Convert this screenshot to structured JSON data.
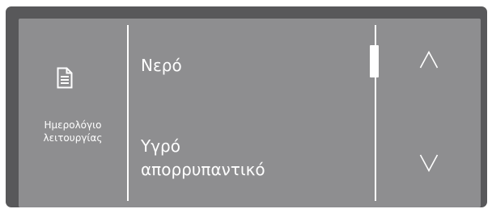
{
  "sidebar": {
    "icon": "document-icon",
    "label_line1": "Ημερολόγιο",
    "label_line2": "λειτουργίας"
  },
  "menu": {
    "items": [
      {
        "lines": [
          "Νερό"
        ]
      },
      {
        "lines": [
          "Υγρό",
          "απορρυπαντικό"
        ]
      }
    ]
  },
  "scroll": {
    "position_fraction": 0.0
  },
  "nav": {
    "up_icon": "chevron-up-icon",
    "down_icon": "chevron-down-icon"
  },
  "colors": {
    "bezel": "#58585a",
    "screen": "#8e8e90",
    "foreground": "#ffffff"
  }
}
